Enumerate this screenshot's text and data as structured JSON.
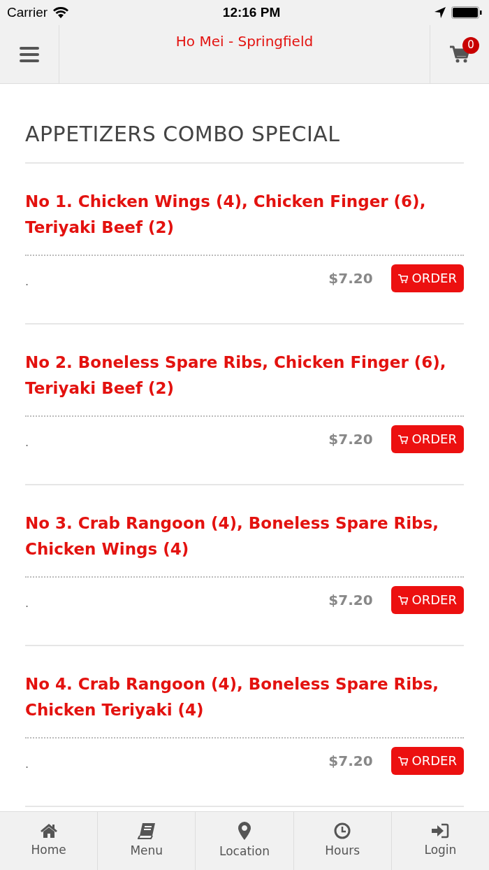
{
  "status_bar": {
    "carrier": "Carrier",
    "time": "12:16 PM"
  },
  "header": {
    "title": "Ho Mei - Springfield",
    "cart_count": "0"
  },
  "section": {
    "title": "APPETIZERS COMBO SPECIAL"
  },
  "items": [
    {
      "name": "No 1. Chicken Wings (4), Chicken Finger (6), Teriyaki Beef (2)",
      "description": ".",
      "price": "$7.20",
      "button": "ORDER"
    },
    {
      "name": "No 2. Boneless Spare Ribs, Chicken Finger (6), Teriyaki Beef (2)",
      "description": ".",
      "price": "$7.20",
      "button": "ORDER"
    },
    {
      "name": "No 3. Crab Rangoon (4), Boneless Spare Ribs, Chicken Wings (4)",
      "description": ".",
      "price": "$7.20",
      "button": "ORDER"
    },
    {
      "name": "No 4. Crab Rangoon (4), Boneless Spare Ribs, Chicken Teriyaki (4)",
      "description": ".",
      "price": "$7.20",
      "button": "ORDER"
    }
  ],
  "tab_bar": [
    {
      "kind": "home",
      "label": "Home"
    },
    {
      "kind": "menu",
      "label": "Menu"
    },
    {
      "kind": "location",
      "label": "Location"
    },
    {
      "kind": "hours",
      "label": "Hours"
    },
    {
      "kind": "login",
      "label": "Login"
    }
  ]
}
